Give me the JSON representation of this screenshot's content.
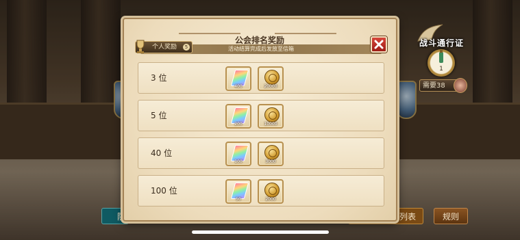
{
  "dialog": {
    "title": "公会排名奖励",
    "subtitle": "活动结算完成后发放至信箱",
    "tab_label": "个人奖励",
    "tab_count": "5",
    "close_label": "×"
  },
  "rewards": [
    {
      "rank": "3 位",
      "crystal_qty": "400",
      "coin_qty": "20000"
    },
    {
      "rank": "5 位",
      "crystal_qty": "200",
      "coin_qty": "10000"
    },
    {
      "rank": "40 位",
      "crystal_qty": "100",
      "coin_qty": "3000"
    },
    {
      "rank": "100 位",
      "crystal_qty": "50",
      "coin_qty": "2000"
    }
  ],
  "hud": {
    "pass_title": "战斗通行证",
    "pass_level": "1",
    "pass_tag": "需要38"
  },
  "bottom": {
    "left_button": "防",
    "mid_button": "列表",
    "rules_button": "规则"
  },
  "colors": {
    "close_red": "#c8352b",
    "panel_bg": "#efe1c4",
    "accent_gold": "#b79050"
  }
}
